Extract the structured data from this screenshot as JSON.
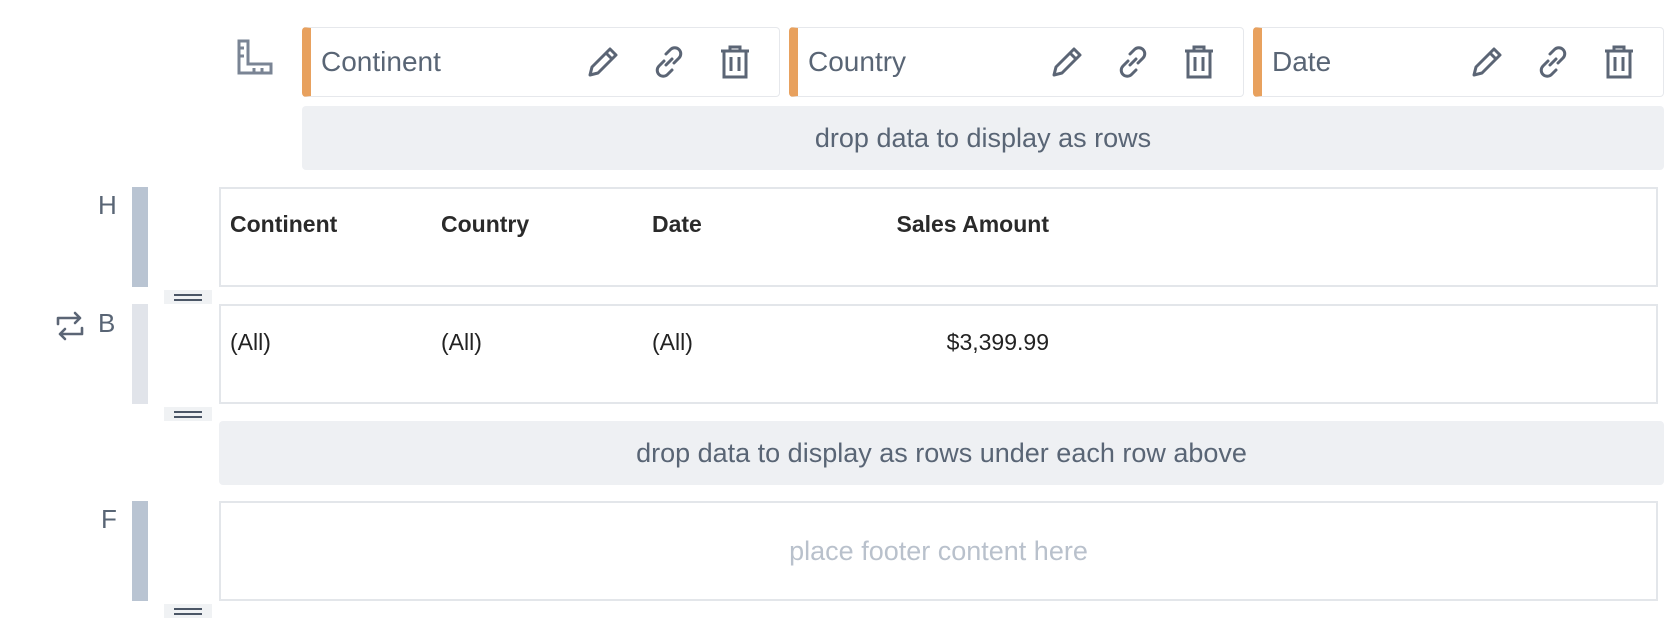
{
  "header_tokens": [
    {
      "label": "Continent",
      "icons": [
        "pencil-icon",
        "link-icon",
        "trash-icon"
      ]
    },
    {
      "label": "Country",
      "icons": [
        "pencil-icon",
        "link-icon",
        "trash-icon"
      ]
    },
    {
      "label": "Date",
      "icons": [
        "pencil-icon",
        "link-icon",
        "trash-icon"
      ]
    }
  ],
  "rows_dropzone": "drop data to display as rows",
  "sub_rows_dropzone": "drop data to display as rows under each row above",
  "bands": {
    "header": {
      "label": "H",
      "columns": [
        "Continent",
        "Country",
        "Date",
        "Sales Amount"
      ]
    },
    "body": {
      "label": "B",
      "cells": [
        "(All)",
        "(All)",
        "(All)",
        "$3,399.99"
      ]
    },
    "footer": {
      "label": "F",
      "placeholder": "place footer content here"
    }
  },
  "colors": {
    "token_accent": "#e8a15e",
    "sidebar_active": "#b9c4d2",
    "sidebar_inactive": "#e1e4ea",
    "dropzone_bg": "#eef0f3"
  }
}
